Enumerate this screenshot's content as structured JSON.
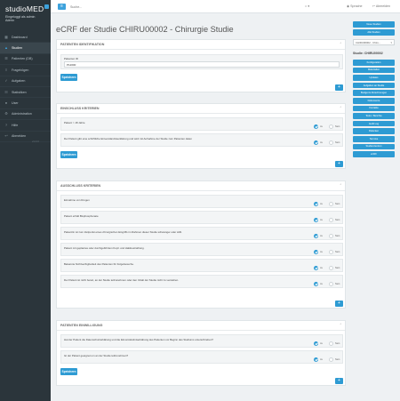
{
  "app": {
    "logo": "studioMED",
    "login_line1": "Eingeloggt als admin",
    "login_line2": "Admin"
  },
  "sidebar": {
    "items": [
      {
        "icon": "dashboard-icon",
        "label": "Dashboard",
        "active": false
      },
      {
        "icon": "studies-icon",
        "label": "Studien",
        "active": true
      },
      {
        "icon": "patients-icon",
        "label": "Patienten (DB)",
        "active": false
      },
      {
        "icon": "questionnaire-icon",
        "label": "Fragebögen",
        "active": false
      },
      {
        "icon": "tasks-icon",
        "label": "Aufgaben",
        "active": false
      },
      {
        "icon": "reports-icon",
        "label": "Statistiken",
        "active": false
      },
      {
        "icon": "user-icon",
        "label": "User",
        "active": false
      },
      {
        "icon": "admin-icon",
        "label": "Administration",
        "active": false
      },
      {
        "icon": "help-icon",
        "label": "Hilfe",
        "active": false
      },
      {
        "icon": "logout-icon",
        "label": "Abmelden",
        "active": false
      }
    ],
    "version": "v1.0.0"
  },
  "topbar": {
    "search_placeholder": "Suche...",
    "language": "Sprache",
    "logout": "Abmelden"
  },
  "page": {
    "title": "eCRF der Studie CHIRU00002 - Chirurgie Studie"
  },
  "panels": {
    "patient_id": {
      "title": "PATIENTEN IDENTIFIKATION",
      "field_label": "Patienten ID",
      "field_value": "P12000",
      "save_label": "Speichern"
    },
    "einschluss": {
      "title": "EINSCHLUSS KRITERIEN",
      "rows": [
        {
          "text": "Patient > 18 Jahre",
          "answer": "Ja"
        },
        {
          "text": "Der Patient gibt eine schriftliche Einverständniserklärung und wird mit Aufnahme der Studie zum Patienten daten",
          "answer": "Ja"
        }
      ],
      "save_label": "Speichern"
    },
    "ausschluss": {
      "title": "AUSSCHLUSS KRITERIEN",
      "rows": [
        {
          "text": "Einnahme von Drogen",
          "answer": "Ja"
        },
        {
          "text": "Patient erhält Bisphosphonate",
          "answer": "Ja"
        },
        {
          "text": "Patient/in ist zum Zeitpunkt eines chirurgischen Eingriffs im Rahmen dieser Studie schwanger oder stillt.",
          "answer": "Ja"
        },
        {
          "text": "Patient mit geplantes oder durchgeführtem Kopf- und Halsbestrahlung.",
          "answer": "Ja"
        },
        {
          "text": "Bekannte Nichtverfügbarkeit des Patienten für Folgebesuche.",
          "answer": "Ja"
        },
        {
          "text": "Der Patient ist nicht bereit, an der Studie teilzunehmen oder den Inhalt der Studie nicht zu verstehen.",
          "answer": "Ja"
        }
      ],
      "save_label": "Speichern"
    },
    "einwilligung": {
      "title": "PATIENTEN EINWILLIGUNG",
      "rows": [
        {
          "text": "Hat der Patient die Datenschutzerklärung und die Einverständniserklärung des Patienten vor Beginn des Studiums unterschrieben?",
          "answer": "Ja"
        },
        {
          "text": "Ist der Patient geeignet um an der Studie teilzunehmen?",
          "answer": "Ja"
        }
      ],
      "save_label": "Speichern"
    }
  },
  "options": {
    "yes": "Ja",
    "no": "Nein"
  },
  "right": {
    "btn_new_study": "Neue Studien",
    "btn_all_studies": "Alle Studien",
    "select_value": "CHIRU00002 - Chiru...",
    "study_title": "Studie: CHIRU00002",
    "buttons": [
      "Konfiguration",
      "Materialien",
      "Updates",
      "Aufgaben an Studie",
      "Budget & Abrechnungen",
      "Dokumente",
      "Kontakte",
      "Tools / Berichte",
      "Audit Log",
      "Patienten",
      "Termine",
      "Studienzentren",
      "eCRF"
    ]
  },
  "colors": {
    "accent": "#2e9bd3",
    "sidebar_bg": "#2b353b"
  }
}
